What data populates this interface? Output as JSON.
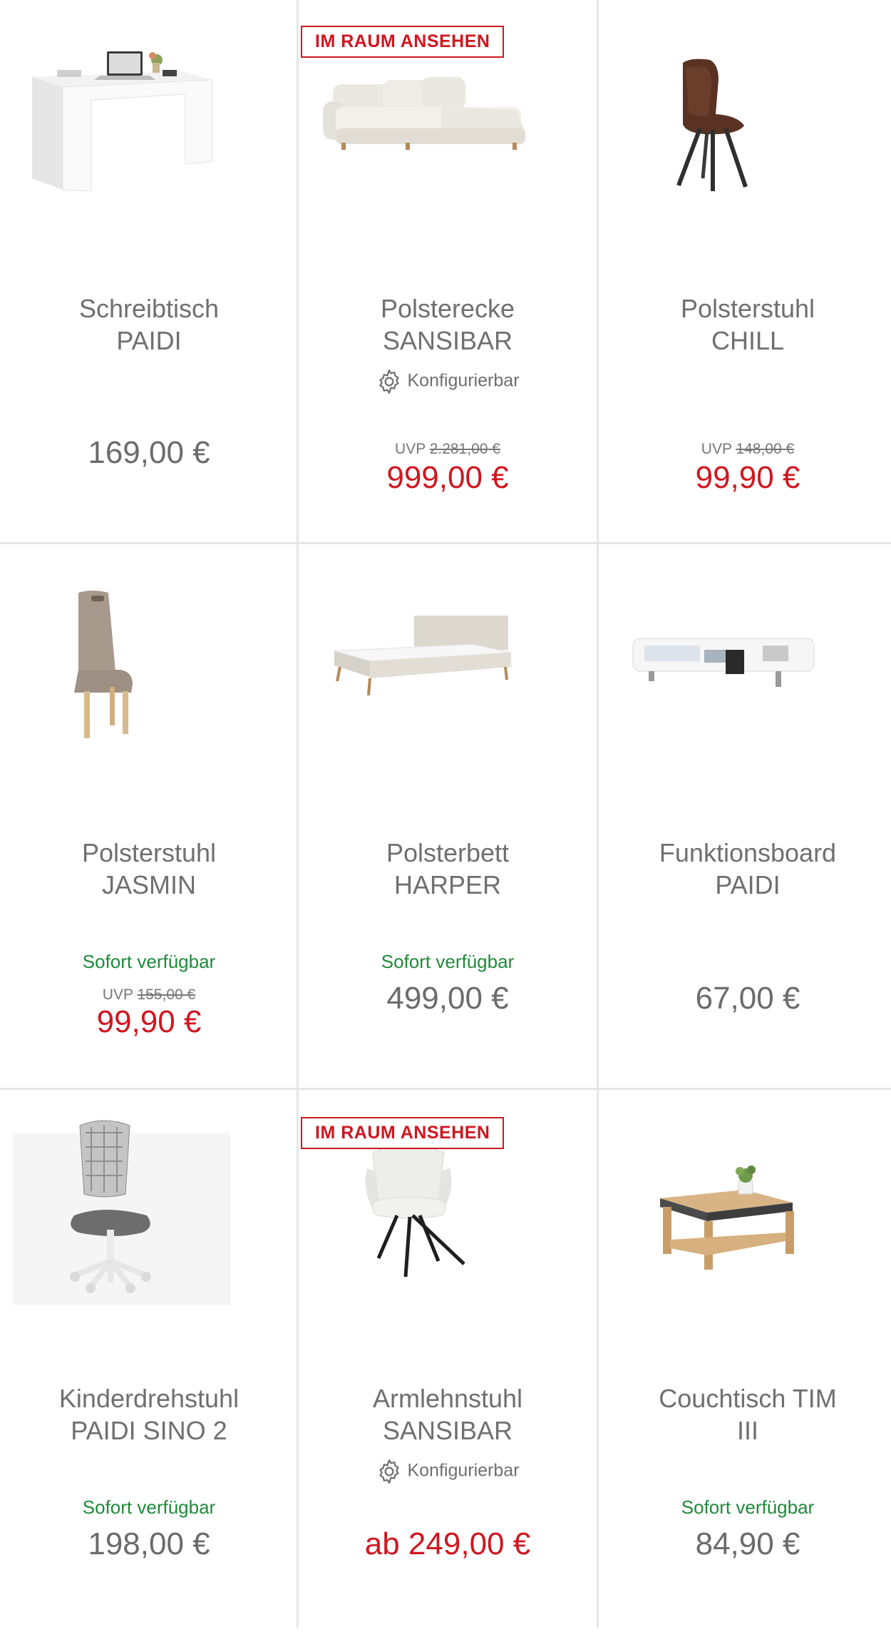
{
  "products": [
    {
      "badge": "",
      "name_line1": "Schreibtisch",
      "name_line2": "PAIDI",
      "configurable": "",
      "availability": "",
      "uvp_label": "",
      "uvp_value": "",
      "price": "169,00 €",
      "icon": "desk-icon"
    },
    {
      "badge": "IM RAUM ANSEHEN",
      "name_line1": "Polsterecke",
      "name_line2": "SANSIBAR",
      "configurable": "Konfigurierbar",
      "availability": "",
      "uvp_label": "UVP",
      "uvp_value": "2.281,00 €",
      "price": "999,00 €",
      "icon": "sofa-icon"
    },
    {
      "badge": "",
      "name_line1": "Polsterstuhl",
      "name_line2": "CHILL",
      "configurable": "",
      "availability": "",
      "uvp_label": "UVP",
      "uvp_value": "148,00 €",
      "price": "99,90 €",
      "icon": "chair-icon"
    },
    {
      "badge": "",
      "name_line1": "Polsterstuhl",
      "name_line2": "JASMIN",
      "configurable": "",
      "availability": "Sofort verfügbar",
      "uvp_label": "UVP",
      "uvp_value": "155,00 €",
      "price": "99,90 €",
      "icon": "chair-icon"
    },
    {
      "badge": "",
      "name_line1": "Polsterbett",
      "name_line2": "HARPER",
      "configurable": "",
      "availability": "Sofort verfügbar",
      "uvp_label": "",
      "uvp_value": "",
      "price": "499,00 €",
      "icon": "bed-icon"
    },
    {
      "badge": "",
      "name_line1": "Funktionsboard",
      "name_line2": "PAIDI",
      "configurable": "",
      "availability": "",
      "uvp_label": "",
      "uvp_value": "",
      "price": "67,00 €",
      "icon": "shelf-icon"
    },
    {
      "badge": "",
      "name_line1": "Kinderdrehstuhl",
      "name_line2": "PAIDI SINO 2",
      "configurable": "",
      "availability": "Sofort verfügbar",
      "uvp_label": "",
      "uvp_value": "",
      "price": "198,00 €",
      "icon": "office-chair-icon"
    },
    {
      "badge": "IM RAUM ANSEHEN",
      "name_line1": "Armlehnstuhl",
      "name_line2": "SANSIBAR",
      "configurable": "Konfigurierbar",
      "availability": "",
      "uvp_label": "",
      "uvp_value": "",
      "price": "ab 249,00 €",
      "icon": "armchair-icon"
    },
    {
      "badge": "",
      "name_line1": "Couchtisch TIM",
      "name_line2": "III",
      "configurable": "",
      "availability": "Sofort verfügbar",
      "uvp_label": "",
      "uvp_value": "",
      "price": "84,90 €",
      "icon": "coffee-table-icon"
    }
  ],
  "colors": {
    "sale": "#d0161f",
    "available": "#1f8a3a",
    "text": "#6b6b6b",
    "divider": "#e6e6e6"
  }
}
